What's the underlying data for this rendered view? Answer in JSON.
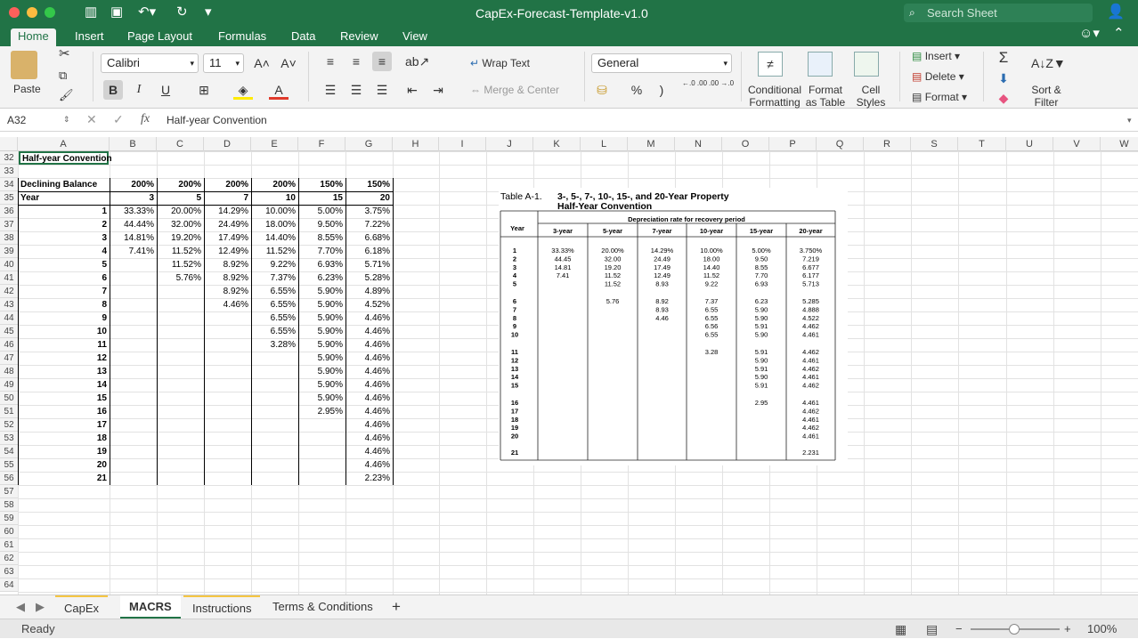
{
  "app": {
    "title": "CapEx-Forecast-Template-v1.0",
    "search_placeholder": "Search Sheet"
  },
  "ribbon_tabs": [
    "Home",
    "Insert",
    "Page Layout",
    "Formulas",
    "Data",
    "Review",
    "View"
  ],
  "ribbon": {
    "paste": "Paste",
    "font_name": "Calibri",
    "font_size": "11",
    "bold": "B",
    "italic": "I",
    "underline": "U",
    "wrap_text": "Wrap Text",
    "merge_center": "Merge & Center",
    "number_format": "General",
    "percent": "%",
    "comma": ")",
    "inc_decimal": "←.0 .00",
    "dec_decimal": ".00 →.0",
    "cond_format": "Conditional Formatting",
    "format_table": "Format as Table",
    "cell_styles": "Cell Styles",
    "insert": "Insert",
    "delete": "Delete",
    "format": "Format",
    "sort_filter": "Sort & Filter"
  },
  "formula_bar": {
    "cell_ref": "A32",
    "fx": "fx",
    "content": "Half-year Convention"
  },
  "columns": [
    "A",
    "B",
    "C",
    "D",
    "E",
    "F",
    "G",
    "H",
    "I",
    "J",
    "K",
    "L",
    "M",
    "N",
    "O",
    "P",
    "Q",
    "R",
    "S",
    "T",
    "U",
    "V",
    "W"
  ],
  "rows": [
    "32",
    "33",
    "34",
    "35",
    "36",
    "37",
    "38",
    "39",
    "40",
    "41",
    "42",
    "43",
    "44",
    "45",
    "46",
    "47",
    "48",
    "49",
    "50",
    "51",
    "52",
    "53",
    "54",
    "55",
    "56",
    "57",
    "58",
    "59",
    "60",
    "61",
    "62",
    "63",
    "64"
  ],
  "sheet": {
    "a32": "Half-year Convention",
    "a34": "Declining Balance",
    "a35": "Year",
    "rates": [
      "200%",
      "200%",
      "200%",
      "200%",
      "150%",
      "150%"
    ],
    "periods": [
      "3",
      "5",
      "7",
      "10",
      "15",
      "20"
    ],
    "years": [
      "1",
      "2",
      "3",
      "4",
      "5",
      "6",
      "7",
      "8",
      "9",
      "10",
      "11",
      "12",
      "13",
      "14",
      "15",
      "16",
      "17",
      "18",
      "19",
      "20",
      "21"
    ],
    "col_b": [
      "33.33%",
      "44.44%",
      "14.81%",
      "7.41%"
    ],
    "col_c": [
      "20.00%",
      "32.00%",
      "19.20%",
      "11.52%",
      "11.52%",
      "5.76%"
    ],
    "col_d": [
      "14.29%",
      "24.49%",
      "17.49%",
      "12.49%",
      "8.92%",
      "8.92%",
      "8.92%",
      "4.46%"
    ],
    "col_e": [
      "10.00%",
      "18.00%",
      "14.40%",
      "11.52%",
      "9.22%",
      "7.37%",
      "6.55%",
      "6.55%",
      "6.55%",
      "6.55%",
      "3.28%"
    ],
    "col_f": [
      "5.00%",
      "9.50%",
      "8.55%",
      "7.70%",
      "6.93%",
      "6.23%",
      "5.90%",
      "5.90%",
      "5.90%",
      "5.90%",
      "5.90%",
      "5.90%",
      "5.90%",
      "5.90%",
      "5.90%",
      "2.95%"
    ],
    "col_g": [
      "3.75%",
      "7.22%",
      "6.68%",
      "6.18%",
      "5.71%",
      "5.28%",
      "4.89%",
      "4.52%",
      "4.46%",
      "4.46%",
      "4.46%",
      "4.46%",
      "4.46%",
      "4.46%",
      "4.46%",
      "4.46%",
      "4.46%",
      "4.46%",
      "4.46%",
      "4.46%",
      "2.23%"
    ]
  },
  "table_image": {
    "caption_left": "Table A-1.",
    "caption_title": "3-, 5-, 7-, 10-, 15-, and 20-Year Property",
    "caption_sub": "Half-Year Convention",
    "header_group": "Depreciation rate for recovery period",
    "year_label": "Year",
    "headers": [
      "3-year",
      "5-year",
      "7-year",
      "10-year",
      "15-year",
      "20-year"
    ],
    "years": [
      [
        "1",
        "2",
        "3",
        "4",
        "5"
      ],
      [
        "6",
        "7",
        "8",
        "9",
        "10"
      ],
      [
        "11",
        "12",
        "13",
        "14",
        "15"
      ],
      [
        "16",
        "17",
        "18",
        "19",
        "20"
      ],
      [
        "21"
      ]
    ],
    "cols": [
      [
        [
          "33.33%",
          "44.45",
          "14.81",
          "7.41"
        ],
        [],
        [],
        [],
        []
      ],
      [
        [
          "20.00%",
          "32.00",
          "19.20",
          "11.52",
          "11.52"
        ],
        [
          "5.76"
        ],
        [],
        [],
        []
      ],
      [
        [
          "14.29%",
          "24.49",
          "17.49",
          "12.49",
          "8.93"
        ],
        [
          "8.92",
          "8.93",
          "4.46"
        ],
        [],
        [],
        []
      ],
      [
        [
          "10.00%",
          "18.00",
          "14.40",
          "11.52",
          "9.22"
        ],
        [
          "7.37",
          "6.55",
          "6.55",
          "6.56",
          "6.55"
        ],
        [
          "3.28"
        ],
        [],
        []
      ],
      [
        [
          "5.00%",
          "9.50",
          "8.55",
          "7.70",
          "6.93"
        ],
        [
          "6.23",
          "5.90",
          "5.90",
          "5.91",
          "5.90"
        ],
        [
          "5.91",
          "5.90",
          "5.91",
          "5.90",
          "5.91"
        ],
        [
          "2.95"
        ],
        []
      ],
      [
        [
          "3.750%",
          "7.219",
          "6.677",
          "6.177",
          "5.713"
        ],
        [
          "5.285",
          "4.888",
          "4.522",
          "4.462",
          "4.461"
        ],
        [
          "4.462",
          "4.461",
          "4.462",
          "4.461",
          "4.462"
        ],
        [
          "4.461",
          "4.462",
          "4.461",
          "4.462",
          "4.461"
        ],
        [
          "2.231"
        ]
      ]
    ]
  },
  "sheet_tabs": [
    "CapEx",
    "MACRS",
    "Instructions",
    "Terms & Conditions"
  ],
  "add_sheet": "+",
  "status": {
    "ready": "Ready",
    "zoom": "100%"
  }
}
